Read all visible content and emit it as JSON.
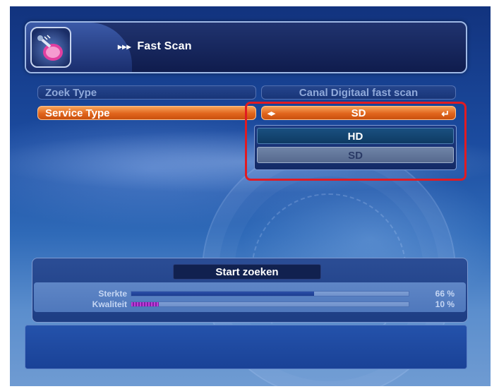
{
  "header": {
    "arrows": "▸▸▸",
    "title": "Fast Scan",
    "icon": "satellite-dish-icon"
  },
  "options": [
    {
      "label": "Zoek Type",
      "value": "Canal Digitaal fast scan",
      "state": "normal"
    },
    {
      "label": "Service Type",
      "value": "SD",
      "state": "active"
    }
  ],
  "service_type_dropdown": {
    "options": [
      "HD",
      "SD"
    ],
    "focused": "HD",
    "selected": "SD"
  },
  "icons": {
    "left_right": "left-right-arrows-icon",
    "enter": "enter-return-icon"
  },
  "signal": {
    "start_label": "Start zoeken",
    "strength_label": "Sterkte",
    "strength_value": "66 %",
    "strength_fraction": 0.66,
    "quality_label": "Kwaliteit",
    "quality_value": "10 %",
    "quality_fraction": 0.1
  },
  "colors": {
    "active_row": "#e0641c",
    "highlight_box": "#e11b22",
    "quality_bar": "#c03cd8",
    "strength_bar": "#2b4fa8"
  }
}
